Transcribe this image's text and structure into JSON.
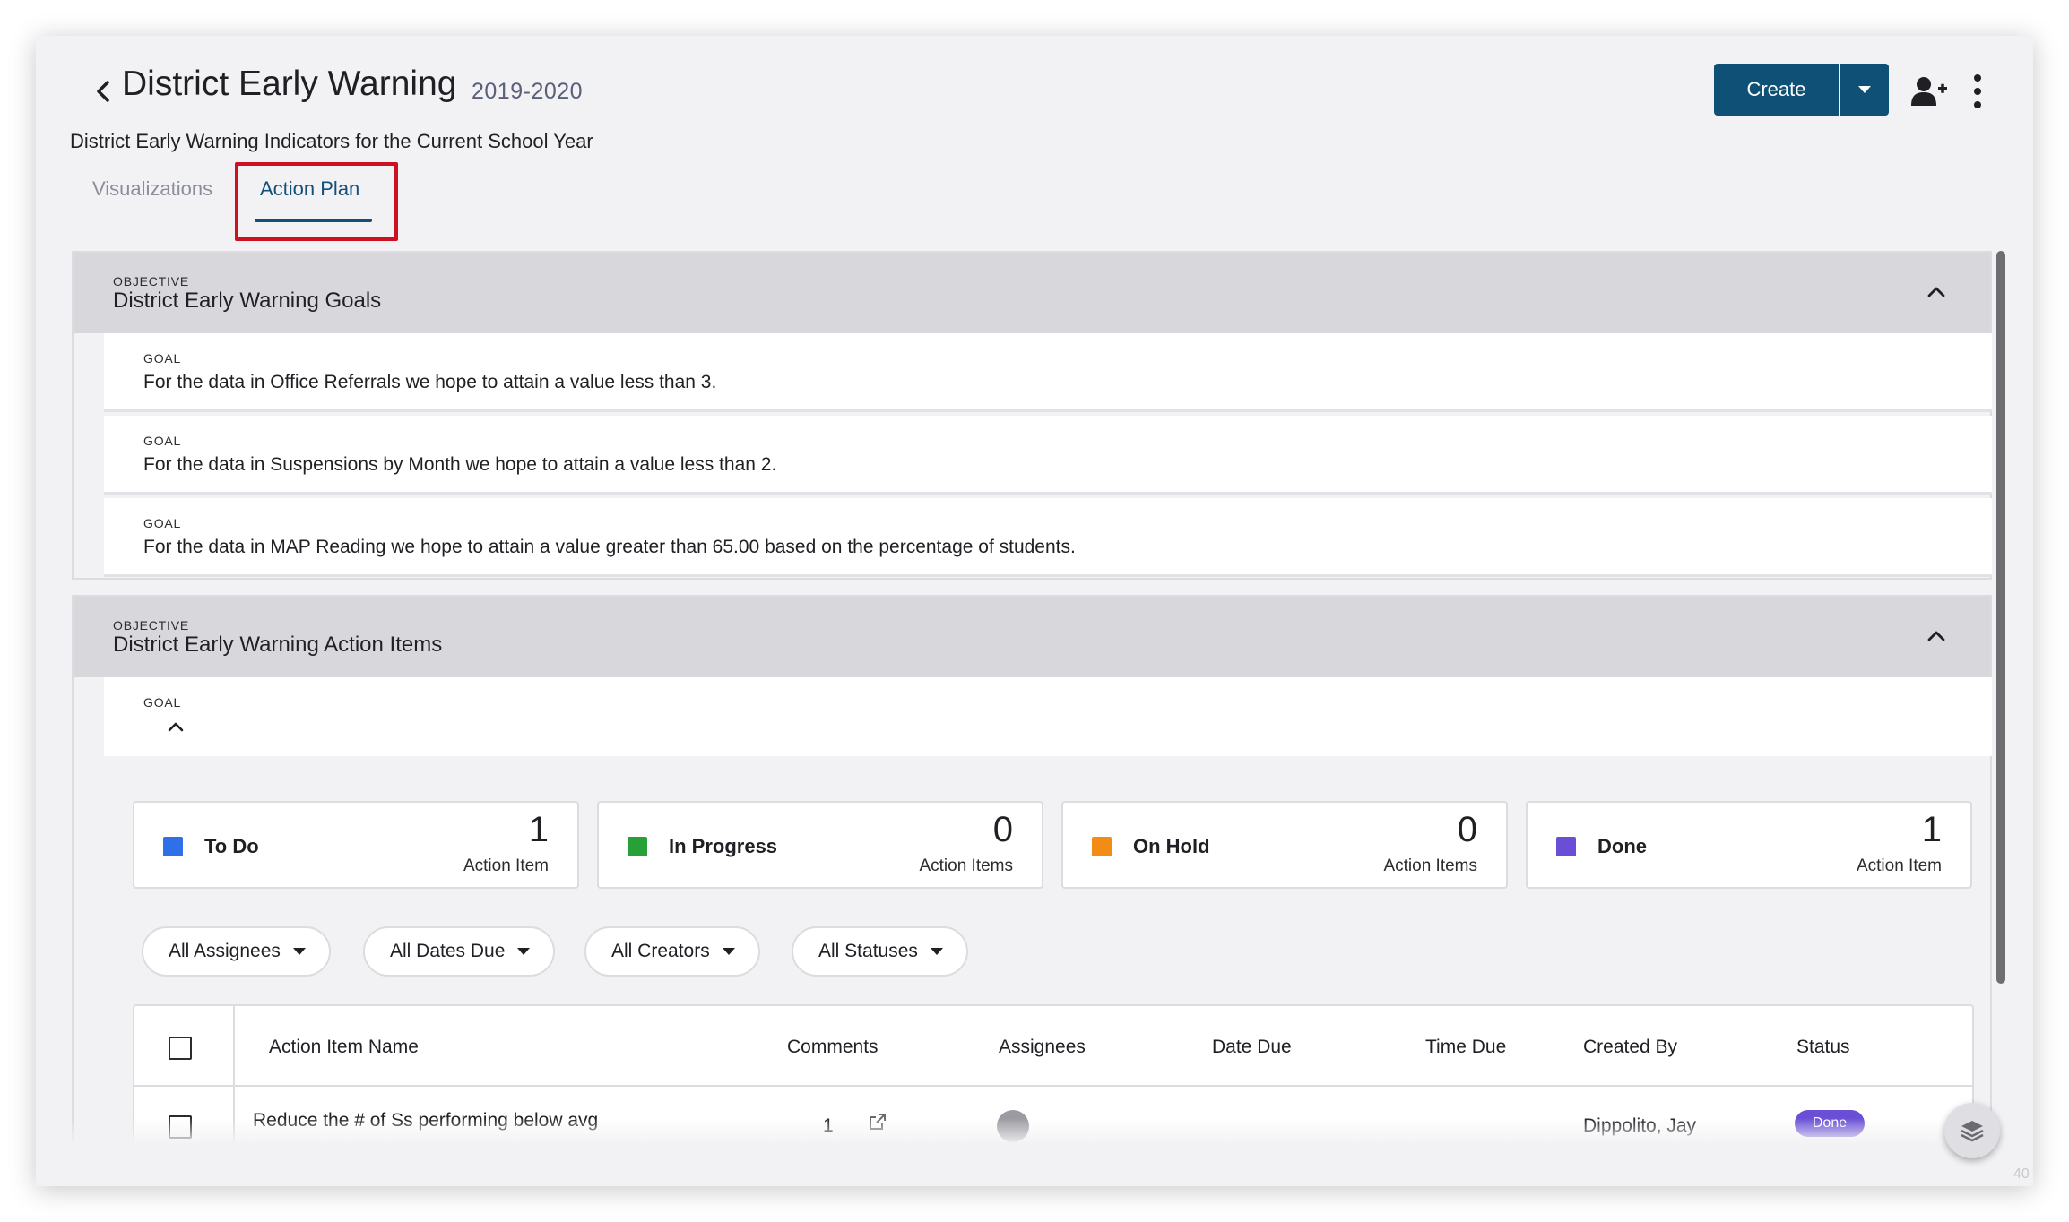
{
  "header": {
    "title": "District Early Warning",
    "year": "2019-2020",
    "subtitle": "District Early Warning Indicators for the Current School Year",
    "create_label": "Create"
  },
  "tabs": [
    {
      "label": "Visualizations",
      "active": false
    },
    {
      "label": "Action Plan",
      "active": true
    }
  ],
  "objectives": [
    {
      "label": "OBJECTIVE",
      "title": "District Early Warning Goals",
      "goals": [
        {
          "label": "GOAL",
          "text": "For the data in Office Referrals we hope to attain a value less than 3."
        },
        {
          "label": "GOAL",
          "text": "For the data in Suspensions by Month we hope to attain a value less than 2."
        },
        {
          "label": "GOAL",
          "text": "For the data in MAP Reading we hope to attain a value greater than 65.00 based on the percentage of students."
        }
      ]
    },
    {
      "label": "OBJECTIVE",
      "title": "District Early Warning Action Items",
      "goals": [
        {
          "label": "GOAL",
          "text": ""
        }
      ]
    }
  ],
  "status_cards": [
    {
      "name": "To Do",
      "count": "1",
      "unit": "Action Item",
      "color": "#2f6fe8"
    },
    {
      "name": "In Progress",
      "count": "0",
      "unit": "Action Items",
      "color": "#27a037"
    },
    {
      "name": "On Hold",
      "count": "0",
      "unit": "Action Items",
      "color": "#f28c16"
    },
    {
      "name": "Done",
      "count": "1",
      "unit": "Action Item",
      "color": "#6a4fd6"
    }
  ],
  "filters": [
    "All Assignees",
    "All Dates Due",
    "All Creators",
    "All Statuses"
  ],
  "table": {
    "columns": [
      "Action Item Name",
      "Comments",
      "Assignees",
      "Date Due",
      "Time Due",
      "Created By",
      "Status"
    ],
    "rows": [
      {
        "name": "Reduce the # of Ss performing below avg",
        "comments": "1",
        "created_by": "Dippolito, Jay",
        "status": "Done"
      }
    ]
  },
  "footer": {
    "corner_text": "40"
  },
  "colors": {
    "primary": "#0f5176",
    "highlight": "#cc1120",
    "status_done": "#6a4fd6"
  }
}
